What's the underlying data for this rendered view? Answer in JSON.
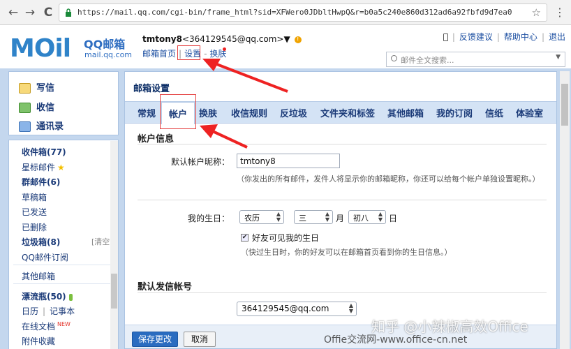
{
  "browser": {
    "back": "←",
    "forward": "→",
    "reload": "C",
    "url": "https://mail.qq.com/cgi-bin/frame_html?sid=XFWero0JDbltHwpQ&r=b0a5c240e860d312ad6a92fbfd9d7ea0",
    "bookmark_star": "☆",
    "menu": "⋮"
  },
  "header": {
    "logo_mark": "MOil",
    "logo_qq": "QQ邮箱",
    "logo_domain": "mail.qq.com",
    "account_name": "tmtony8",
    "account_email": "<364129545@qq.com>▼",
    "warn": "!",
    "nav": {
      "home": "邮箱首页",
      "sep": "|",
      "settings": "设置",
      "dash": "-",
      "skin": "换肤"
    },
    "toplinks": {
      "feedback": "反馈建议",
      "help": "帮助中心",
      "logout": "退出"
    },
    "search_placeholder": "邮件全文搜索...",
    "search_caret": "▼"
  },
  "sidebar": {
    "compose": "写信",
    "receive": "收信",
    "contacts": "通讯录",
    "folders": [
      {
        "label": "收件箱(77)",
        "bold": true
      },
      {
        "label": "星标邮件",
        "bold": false
      },
      {
        "label": "群邮件(6)",
        "bold": true
      },
      {
        "label": "草稿箱",
        "bold": false
      },
      {
        "label": "已发送",
        "bold": false
      },
      {
        "label": "已删除",
        "bold": false
      },
      {
        "label": "垃圾箱(8)",
        "bold": true
      },
      {
        "label": "QQ邮件订阅",
        "bold": false
      },
      {
        "label": "其他邮箱",
        "bold": false
      },
      {
        "label": "漂流瓶(50)",
        "bold": true
      },
      {
        "label": "日历",
        "bold": false
      },
      {
        "label": "在线文档",
        "bold": false
      },
      {
        "label": "附件收藏",
        "bold": false
      }
    ],
    "clear": "[清空]",
    "notes_sep": "|",
    "notes": "记事本",
    "new_badge": "NEW"
  },
  "content": {
    "title": "邮箱设置",
    "tabs": [
      "常规",
      "帐户",
      "换肤",
      "收信规则",
      "反垃圾",
      "文件夹和标签",
      "其他邮箱",
      "我的订阅",
      "信纸",
      "体验室"
    ],
    "section_account": "帐户信息",
    "nickname_label": "默认帐户昵称：",
    "nickname_value": "tmtony8",
    "nickname_hint": "（你发出的所有邮件，发件人将显示你的邮箱昵称，你还可以给每个帐户单独设置昵称。）",
    "birthday_label": "我的生日：",
    "calendar_value": "农历",
    "month_value": "三",
    "month_unit": "月",
    "day_value": "初八",
    "day_unit": "日",
    "birthday_visible_check": "✔",
    "birthday_visible_label": "好友可见我的生日",
    "birthday_hint": "（快过生日时，你的好友可以在邮箱首页看到你的生日信息。）",
    "section_sender": "默认发信帐号",
    "sender_value": "364129545@qq.com",
    "save_button": "保存更改",
    "cancel_button": "取消"
  },
  "watermarks": {
    "zhihu": "知乎 @小辣椒高效Office",
    "site": "Offie交流网-www.office-cn.net"
  }
}
